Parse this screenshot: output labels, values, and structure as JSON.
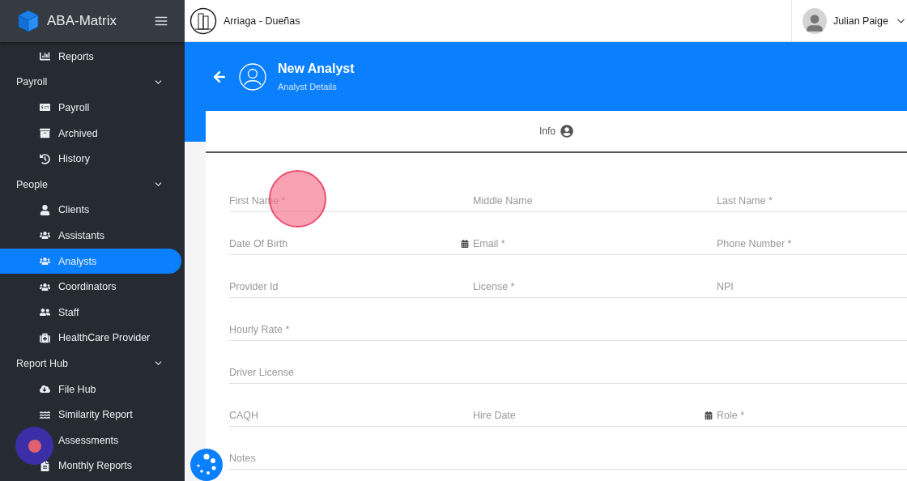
{
  "brand": {
    "name": "ABA-Matrix"
  },
  "company": {
    "name": "Arriaga - Dueñas"
  },
  "user": {
    "name": "Julian Paige"
  },
  "sidebar": {
    "items": [
      {
        "kind": "item",
        "label": "Reports",
        "selected": false
      },
      {
        "kind": "section",
        "label": "Payroll",
        "expanded": true
      },
      {
        "kind": "item",
        "label": "Payroll",
        "selected": false
      },
      {
        "kind": "item",
        "label": "Archived",
        "selected": false
      },
      {
        "kind": "item",
        "label": "History",
        "selected": false
      },
      {
        "kind": "section",
        "label": "People",
        "expanded": true
      },
      {
        "kind": "item",
        "label": "Clients",
        "selected": false
      },
      {
        "kind": "item",
        "label": "Assistants",
        "selected": false
      },
      {
        "kind": "item",
        "label": "Analysts",
        "selected": true
      },
      {
        "kind": "item",
        "label": "Coordinators",
        "selected": false
      },
      {
        "kind": "item",
        "label": "Staff",
        "selected": false
      },
      {
        "kind": "item",
        "label": "HealthCare Provider",
        "selected": false
      },
      {
        "kind": "section",
        "label": "Report Hub",
        "expanded": true
      },
      {
        "kind": "item",
        "label": "File Hub",
        "selected": false
      },
      {
        "kind": "item",
        "label": "Similarity Report",
        "selected": false
      },
      {
        "kind": "item",
        "label": "Assessments",
        "selected": false
      },
      {
        "kind": "item",
        "label": "Monthly Reports",
        "selected": false
      }
    ]
  },
  "page_header": {
    "title": "New Analyst",
    "subtitle": "Analyst Details"
  },
  "tabs": [
    {
      "label": "Info",
      "selected": true
    }
  ],
  "form": {
    "rows": [
      [
        {
          "kind": "text",
          "placeholder": "First Name *"
        },
        {
          "kind": "text",
          "placeholder": "Middle Name"
        },
        {
          "kind": "text",
          "placeholder": "Last Name *"
        }
      ],
      [
        {
          "kind": "date",
          "placeholder": "Date Of Birth"
        },
        {
          "kind": "text",
          "placeholder": "Email *"
        },
        {
          "kind": "text",
          "placeholder": "Phone Number *"
        }
      ],
      [
        {
          "kind": "text",
          "placeholder": "Provider Id"
        },
        {
          "kind": "text",
          "placeholder": "License *"
        },
        {
          "kind": "text",
          "placeholder": "NPI"
        }
      ],
      [
        {
          "kind": "text",
          "placeholder": "Hourly Rate *"
        }
      ],
      [
        {
          "kind": "text",
          "placeholder": "Driver License"
        }
      ],
      [
        {
          "kind": "text",
          "placeholder": "CAQH"
        },
        {
          "kind": "date",
          "placeholder": "Hire Date"
        },
        {
          "kind": "text",
          "placeholder": "Role *"
        }
      ],
      [
        {
          "kind": "text",
          "placeholder": "Notes"
        }
      ]
    ]
  }
}
